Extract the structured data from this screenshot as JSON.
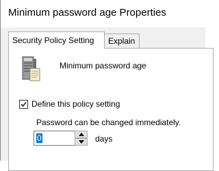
{
  "window": {
    "title": "Minimum password age Properties"
  },
  "tabs": [
    {
      "label": "Security Policy Setting",
      "active": true
    },
    {
      "label": "Explain",
      "active": false
    }
  ],
  "policy": {
    "icon": "server-icon",
    "name": "Minimum password age",
    "define_checkbox_label": "Define this policy setting",
    "define_checked": true,
    "status_text": "Password can be changed immediately.",
    "days_value": "0",
    "unit_label": "days"
  },
  "colors": {
    "selection": "#0078d7",
    "dialog_background": "#f0f0f0",
    "border": "#adadad"
  }
}
